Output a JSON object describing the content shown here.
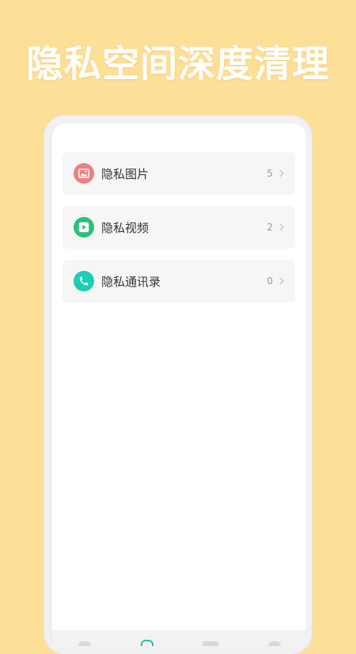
{
  "headline": "隐私空间深度清理",
  "colors": {
    "background": "#FEDF97",
    "photos_icon": "#F07E7E",
    "videos_icon": "#2DBF7C",
    "contacts_icon": "#1DCDB6",
    "active_tab": "#2DBFA8"
  },
  "items": [
    {
      "label": "隐私图片",
      "count": "5",
      "icon": "image-icon"
    },
    {
      "label": "隐私视频",
      "count": "2",
      "icon": "play-icon"
    },
    {
      "label": "隐私通讯录",
      "count": "0",
      "icon": "phone-icon"
    }
  ],
  "tabs": [
    {
      "icon": "home-icon",
      "active": false
    },
    {
      "icon": "clean-icon",
      "active": true
    },
    {
      "icon": "tools-icon",
      "active": false
    },
    {
      "icon": "profile-icon",
      "active": false
    }
  ]
}
